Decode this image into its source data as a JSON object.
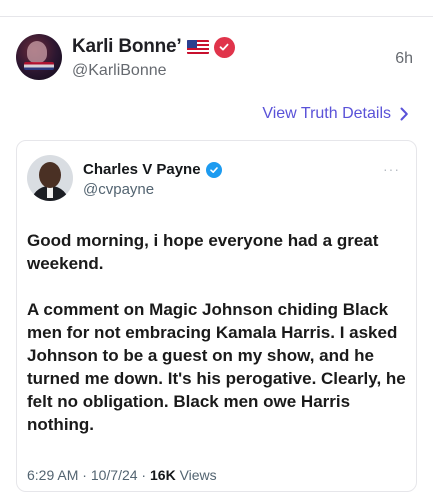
{
  "truth": {
    "display_name": "Karli Bonne’",
    "handle": "@KarliBonne",
    "time": "6h",
    "view_details_label": "View Truth Details"
  },
  "quoted_post": {
    "display_name": "Charles V Payne",
    "handle": "@cvpayne",
    "more": "···",
    "paragraph_1": "Good morning, i hope everyone had a great weekend.",
    "paragraph_2": "A comment on Magic Johnson chiding Black men for not embracing Kamala Harris. I asked Johnson to be a guest on my show, and he turned me down. It's his perogative. Clearly, he felt no obligation. Black men owe Harris nothing.",
    "time": "6:29 AM",
    "separator": " · ",
    "date": "10/7/24",
    "views_count": "16K",
    "views_label": " Views"
  },
  "colors": {
    "accent": "#5a52d8",
    "verified_red": "#e0344b",
    "verified_blue": "#1d9bf0"
  },
  "icons": [
    "us-flag-icon",
    "verified-badge-icon",
    "chevron-right-icon",
    "more-options-icon"
  ]
}
